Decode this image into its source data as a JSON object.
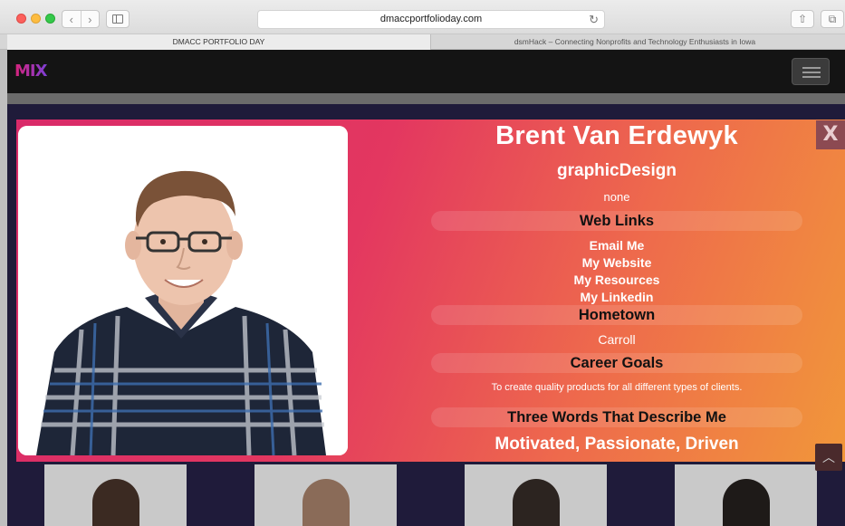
{
  "browser": {
    "url": "dmaccportfolioday.com",
    "tabs": [
      {
        "label": "DMACC PORTFOLIO DAY"
      },
      {
        "label": "dsmHack – Connecting Nonprofits and Technology Enthusiasts in Iowa"
      }
    ]
  },
  "header": {
    "logo_text": "MIX"
  },
  "profile": {
    "name": "Brent Van Erdewyk",
    "major": "graphicDesign",
    "minor": "none",
    "web_links_heading": "Web Links",
    "links": [
      "Email Me",
      "My Website",
      "My Resources",
      "My Linkedin"
    ],
    "hometown_heading": "Hometown",
    "hometown": "Carroll",
    "career_heading": "Career Goals",
    "career_goal": "To create quality products for all different types of clients.",
    "three_words_heading": "Three Words That Describe Me",
    "three_words": "Motivated, Passionate, Driven",
    "close_label": "X"
  },
  "colors": {
    "modal_gradient_start": "#d92a69",
    "modal_gradient_end": "#f1973a",
    "page_background": "#1f1b3a",
    "header_background": "#141414"
  }
}
